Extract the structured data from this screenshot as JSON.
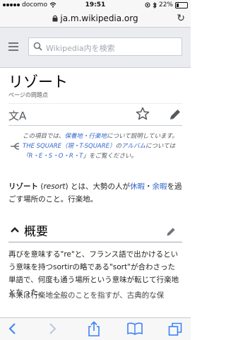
{
  "status_bar": {
    "carrier": "docomo",
    "time": "19:51",
    "battery": "22%",
    "battery_level": 0.22
  },
  "browser": {
    "url": "ja.m.wikipedia.org"
  },
  "header": {
    "search_placeholder": "Wikipedia内を検索"
  },
  "article": {
    "title": "リゾート",
    "subtitle": "ページの問題点",
    "hatnote": {
      "part1": "この項目では、",
      "link1": "保養地",
      "part2": "・",
      "link2": "行楽地",
      "part3": "について説明しています。",
      "link3": "THE SQUARE（現・T-SQUARE）",
      "part4": "の",
      "link4": "アルバム",
      "part5": "については「",
      "link5": "R・E・S・O・R・T",
      "part6": "」をご覧ください。"
    },
    "intro": {
      "bold": "リゾート",
      "paren_open": " (",
      "resort_word": "resort",
      "paren_close": ") とは、大勢の人が",
      "link1": "休暇",
      "sep": "・",
      "link2": "余暇",
      "rest": "を過ごす場所のこと。行楽地。"
    },
    "section": {
      "title": "概要",
      "body": "再びを意味する\"re\"と、フランス語で出かけるという意味を持つsortirの略である\"sort\"が合わさった単語で、何度も通う場所という意味が転じて行楽地となった。",
      "next_partial": "本来は行楽地全般のことを指すが、古典的な保"
    }
  },
  "icons": {
    "accent": "#3366cc"
  }
}
